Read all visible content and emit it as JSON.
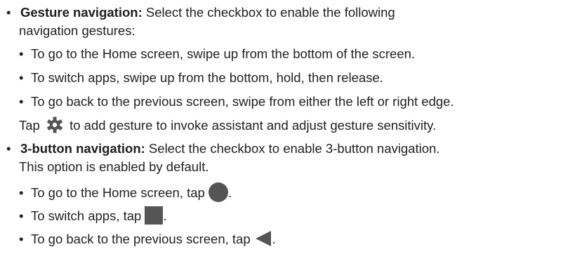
{
  "gesture_item": {
    "term": "Gesture navigation:",
    "desc_line1": " Select the checkbox to enable the following",
    "desc_line2": "navigation gestures:",
    "subitems": [
      "To go to the Home screen, swipe up from the bottom of the screen.",
      "To switch apps, swipe up from the bottom, hold, then release.",
      "To go back to the previous screen, swipe from either the left or right edge."
    ],
    "tap_prefix": "Tap",
    "tap_suffix": "to add gesture to invoke assistant and adjust gesture sensitivity.",
    "tap_icon": "gear-icon"
  },
  "button_item": {
    "term": "3-button navigation:",
    "desc_line1": " Select the checkbox to enable 3-button navigation.",
    "desc_line2": "This option is enabled by default.",
    "subitems": [
      {
        "text": "To go to the Home screen, tap",
        "icon": "home-circle-icon",
        "end": "."
      },
      {
        "text": "To switch apps, tap",
        "icon": "recents-square-icon",
        "end": "."
      },
      {
        "text": "To go back to the previous screen, tap",
        "icon": "back-triangle-icon",
        "end": "."
      }
    ]
  },
  "colors": {
    "icon": "#555555",
    "text": "#222222"
  }
}
